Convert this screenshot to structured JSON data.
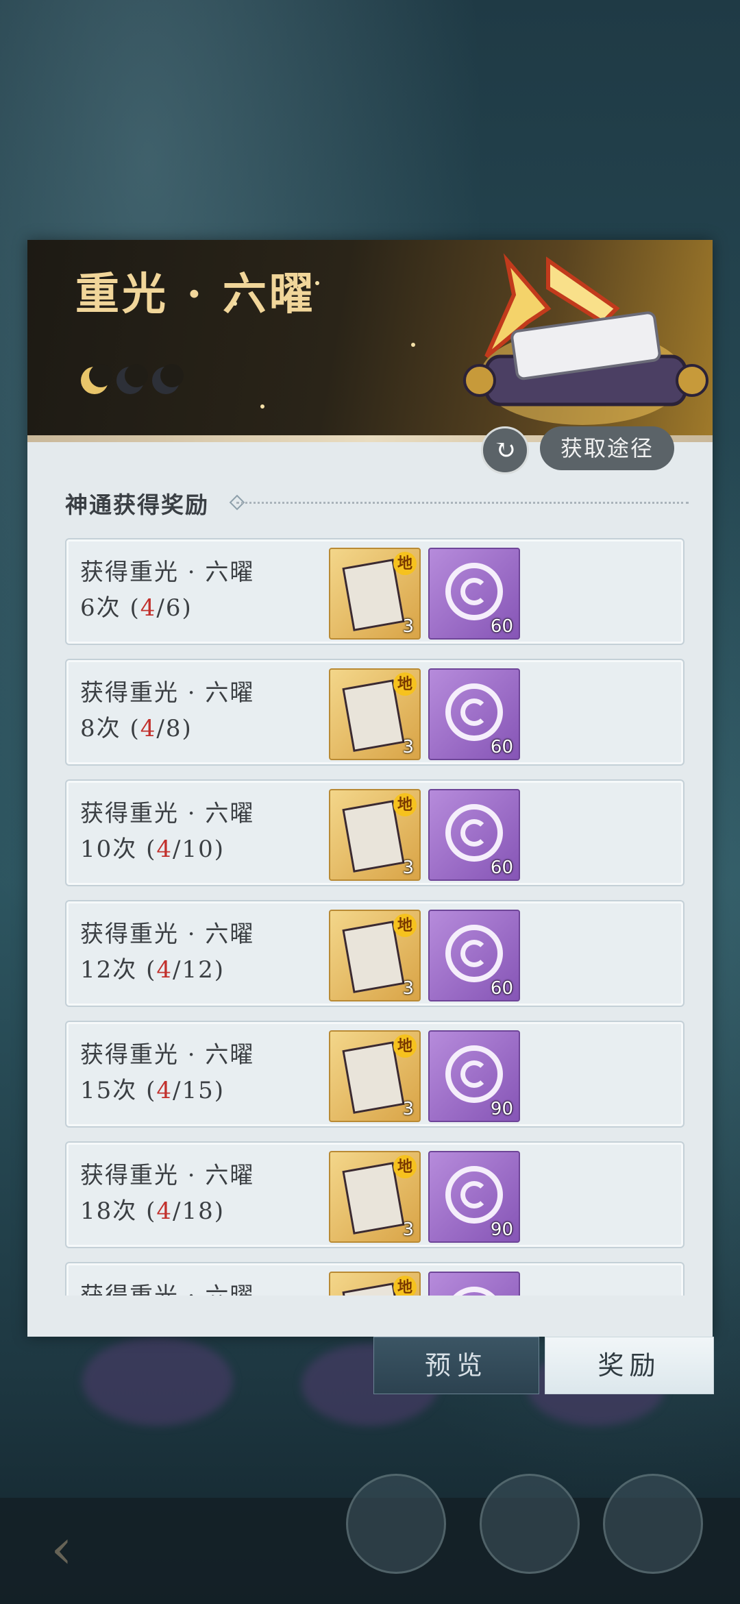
{
  "panel": {
    "title": "重光 · 六曜",
    "source_button": "获取途径",
    "section_title": "神通获得奖励"
  },
  "rewards": [
    {
      "label": "获得重光 · 六曜",
      "count_text": "6次",
      "current": "4",
      "total": "6",
      "item1_count": "3",
      "item1_tag": "地",
      "item2_count": "60"
    },
    {
      "label": "获得重光 · 六曜",
      "count_text": "8次",
      "current": "4",
      "total": "8",
      "item1_count": "3",
      "item1_tag": "地",
      "item2_count": "60"
    },
    {
      "label": "获得重光 · 六曜",
      "count_text": "10次",
      "current": "4",
      "total": "10",
      "item1_count": "3",
      "item1_tag": "地",
      "item2_count": "60"
    },
    {
      "label": "获得重光 · 六曜",
      "count_text": "12次",
      "current": "4",
      "total": "12",
      "item1_count": "3",
      "item1_tag": "地",
      "item2_count": "60"
    },
    {
      "label": "获得重光 · 六曜",
      "count_text": "15次",
      "current": "4",
      "total": "15",
      "item1_count": "3",
      "item1_tag": "地",
      "item2_count": "90"
    },
    {
      "label": "获得重光 · 六曜",
      "count_text": "18次",
      "current": "4",
      "total": "18",
      "item1_count": "3",
      "item1_tag": "地",
      "item2_count": "90"
    },
    {
      "label": "获得重光 · 六曜",
      "item1_tag": "地"
    }
  ],
  "tabs": {
    "preview": "预览",
    "reward": "奖励"
  },
  "colors": {
    "title_gold": "#f1d69a",
    "progress_red": "#c2302c",
    "panel_bg": "#e4eaed"
  },
  "icons": {
    "refresh": "refresh-icon",
    "back": "back-arrow-icon",
    "item1": "skill-book-icon",
    "item2": "swirl-token-icon"
  }
}
